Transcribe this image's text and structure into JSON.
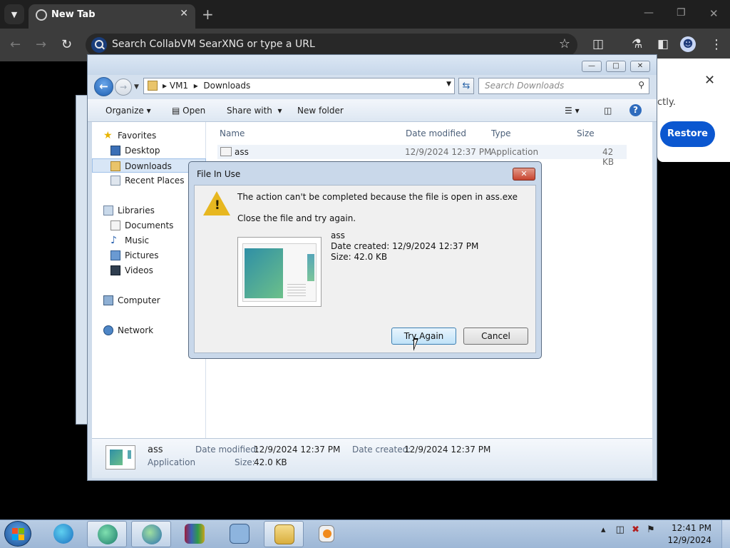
{
  "chrome": {
    "tab_title": "New Tab",
    "omnibox_text": "Search CollabVM SearXNG or type a URL",
    "restore_snippet": "ctly.",
    "restore_button": "Restore"
  },
  "explorer": {
    "breadcrumb": [
      "VM1",
      "Downloads"
    ],
    "search_placeholder": "Search Downloads",
    "commands": {
      "organize": "Organize",
      "open": "Open",
      "share_with": "Share with",
      "new_folder": "New folder"
    },
    "nav": {
      "favorites": "Favorites",
      "desktop": "Desktop",
      "downloads": "Downloads",
      "recent_places": "Recent Places",
      "libraries": "Libraries",
      "documents": "Documents",
      "music": "Music",
      "pictures": "Pictures",
      "videos": "Videos",
      "computer": "Computer",
      "network": "Network"
    },
    "columns": {
      "name": "Name",
      "date_modified": "Date modified",
      "type": "Type",
      "size": "Size"
    },
    "file": {
      "name": "ass",
      "date_modified": "12/9/2024 12:37 PM",
      "type": "Application",
      "size": "42 KB"
    },
    "details": {
      "name": "ass",
      "type": "Application",
      "date_modified_label": "Date modified:",
      "date_modified": "12/9/2024 12:37 PM",
      "date_created_label": "Date created:",
      "date_created": "12/9/2024 12:37 PM",
      "size_label": "Size:",
      "size": "42.0 KB"
    }
  },
  "dialog": {
    "title": "File In Use",
    "message": "The action can't be completed because the file is open in ass.exe",
    "sub": "Close the file and try again.",
    "file_name": "ass",
    "date_created": "Date created: 12/9/2024 12:37 PM",
    "size": "Size: 42.0 KB",
    "try_again": "Try Again",
    "cancel": "Cancel"
  },
  "taskbar": {
    "time": "12:41 PM",
    "date": "12/9/2024"
  }
}
